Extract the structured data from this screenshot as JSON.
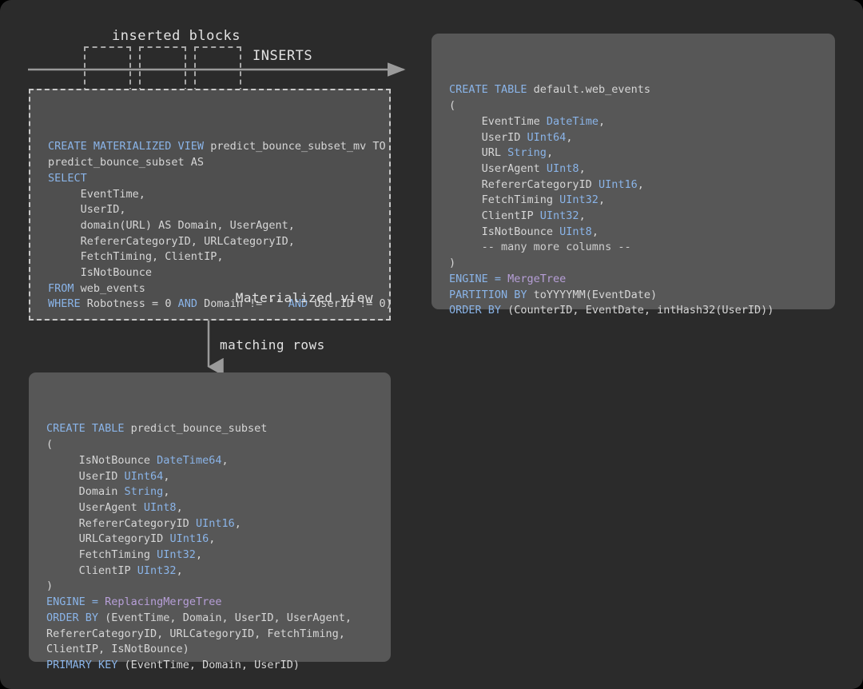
{
  "diagram": {
    "title_labels": {
      "inserted_blocks": "inserted blocks",
      "inserts": "INSERTS",
      "matching_rows": "matching rows",
      "materialized_view_caption": "Materialized view"
    },
    "colors": {
      "page_background": "#2b2b2b",
      "outer_border": "#000000",
      "panel_dashed_background": "#4f4f4f",
      "panel_solid_background": "#575757",
      "keyword": "#8ab4e8",
      "engine": "#b79fd8",
      "plain_text": "#d6d6d6",
      "arrow": "#9a9a9a",
      "dashed_border": "#c9c9c9"
    },
    "inserted_block_count": 3
  },
  "materialized_view_panel": {
    "caption": "Materialized view",
    "lines": [
      [
        {
          "t": "CREATE MATERIALIZED VIEW ",
          "c": "kw"
        },
        {
          "t": "predict_bounce_subset_mv TO",
          "c": "plain"
        }
      ],
      [
        {
          "t": "predict_bounce_subset AS",
          "c": "plain"
        }
      ],
      [
        {
          "t": "SELECT",
          "c": "kw"
        }
      ],
      [
        {
          "t": "     EventTime,",
          "c": "plain"
        }
      ],
      [
        {
          "t": "     UserID,",
          "c": "plain"
        }
      ],
      [
        {
          "t": "     domain(URL) AS Domain, UserAgent,",
          "c": "plain"
        }
      ],
      [
        {
          "t": "     RefererCategoryID, URLCategoryID,",
          "c": "plain"
        }
      ],
      [
        {
          "t": "     FetchTiming, ClientIP,",
          "c": "plain"
        }
      ],
      [
        {
          "t": "     IsNotBounce",
          "c": "plain"
        }
      ],
      [
        {
          "t": "FROM ",
          "c": "kw"
        },
        {
          "t": "web_events",
          "c": "plain"
        }
      ],
      [
        {
          "t": "WHERE ",
          "c": "kw"
        },
        {
          "t": "Robotness = 0 ",
          "c": "plain"
        },
        {
          "t": "AND ",
          "c": "kw"
        },
        {
          "t": "Domain != '' ",
          "c": "plain"
        },
        {
          "t": "AND ",
          "c": "kw"
        },
        {
          "t": "UserID != 0)",
          "c": "plain"
        }
      ]
    ]
  },
  "web_events_panel": {
    "lines": [
      [
        {
          "t": "CREATE TABLE ",
          "c": "kw"
        },
        {
          "t": "default.web_events",
          "c": "plain"
        }
      ],
      [
        {
          "t": "(",
          "c": "plain"
        }
      ],
      [
        {
          "t": "     EventTime ",
          "c": "plain"
        },
        {
          "t": "DateTime",
          "c": "kw"
        },
        {
          "t": ",",
          "c": "plain"
        }
      ],
      [
        {
          "t": "     UserID ",
          "c": "plain"
        },
        {
          "t": "UInt64",
          "c": "kw"
        },
        {
          "t": ",",
          "c": "plain"
        }
      ],
      [
        {
          "t": "     URL ",
          "c": "plain"
        },
        {
          "t": "String",
          "c": "kw"
        },
        {
          "t": ",",
          "c": "plain"
        }
      ],
      [
        {
          "t": "     UserAgent ",
          "c": "plain"
        },
        {
          "t": "UInt8",
          "c": "kw"
        },
        {
          "t": ",",
          "c": "plain"
        }
      ],
      [
        {
          "t": "     RefererCategoryID ",
          "c": "plain"
        },
        {
          "t": "UInt16",
          "c": "kw"
        },
        {
          "t": ",",
          "c": "plain"
        }
      ],
      [
        {
          "t": "     FetchTiming ",
          "c": "plain"
        },
        {
          "t": "UInt32",
          "c": "kw"
        },
        {
          "t": ",",
          "c": "plain"
        }
      ],
      [
        {
          "t": "     ClientIP ",
          "c": "plain"
        },
        {
          "t": "UInt32",
          "c": "kw"
        },
        {
          "t": ",",
          "c": "plain"
        }
      ],
      [
        {
          "t": "     IsNotBounce ",
          "c": "plain"
        },
        {
          "t": "UInt8",
          "c": "kw"
        },
        {
          "t": ",",
          "c": "plain"
        }
      ],
      [
        {
          "t": "     -- many more columns --",
          "c": "cmt"
        }
      ],
      [
        {
          "t": ")",
          "c": "plain"
        }
      ],
      [
        {
          "t": "ENGINE = ",
          "c": "kw"
        },
        {
          "t": "MergeTree",
          "c": "eng"
        }
      ],
      [
        {
          "t": "PARTITION BY ",
          "c": "kw"
        },
        {
          "t": "toYYYYMM(EventDate)",
          "c": "plain"
        }
      ],
      [
        {
          "t": "ORDER BY ",
          "c": "kw"
        },
        {
          "t": "(CounterID, EventDate, intHash32(UserID))",
          "c": "plain"
        }
      ]
    ]
  },
  "subset_table_panel": {
    "lines": [
      [
        {
          "t": "CREATE TABLE ",
          "c": "kw"
        },
        {
          "t": "predict_bounce_subset",
          "c": "plain"
        }
      ],
      [
        {
          "t": "(",
          "c": "plain"
        }
      ],
      [
        {
          "t": "     IsNotBounce ",
          "c": "plain"
        },
        {
          "t": "DateTime64",
          "c": "kw"
        },
        {
          "t": ",",
          "c": "plain"
        }
      ],
      [
        {
          "t": "     UserID ",
          "c": "plain"
        },
        {
          "t": "UInt64",
          "c": "kw"
        },
        {
          "t": ",",
          "c": "plain"
        }
      ],
      [
        {
          "t": "     Domain ",
          "c": "plain"
        },
        {
          "t": "String",
          "c": "kw"
        },
        {
          "t": ",",
          "c": "plain"
        }
      ],
      [
        {
          "t": "     UserAgent ",
          "c": "plain"
        },
        {
          "t": "UInt8",
          "c": "kw"
        },
        {
          "t": ",",
          "c": "plain"
        }
      ],
      [
        {
          "t": "     RefererCategoryID ",
          "c": "plain"
        },
        {
          "t": "UInt16",
          "c": "kw"
        },
        {
          "t": ",",
          "c": "plain"
        }
      ],
      [
        {
          "t": "     URLCategoryID ",
          "c": "plain"
        },
        {
          "t": "UInt16",
          "c": "kw"
        },
        {
          "t": ",",
          "c": "plain"
        }
      ],
      [
        {
          "t": "     FetchTiming ",
          "c": "plain"
        },
        {
          "t": "UInt32",
          "c": "kw"
        },
        {
          "t": ",",
          "c": "plain"
        }
      ],
      [
        {
          "t": "     ClientIP ",
          "c": "plain"
        },
        {
          "t": "UInt32",
          "c": "kw"
        },
        {
          "t": ",",
          "c": "plain"
        }
      ],
      [
        {
          "t": ")",
          "c": "plain"
        }
      ],
      [
        {
          "t": "ENGINE = ",
          "c": "kw"
        },
        {
          "t": "ReplacingMergeTree",
          "c": "eng"
        }
      ],
      [
        {
          "t": "ORDER BY ",
          "c": "kw"
        },
        {
          "t": "(EventTime, Domain, UserID, UserAgent,",
          "c": "plain"
        }
      ],
      [
        {
          "t": "RefererCategoryID, URLCategoryID, FetchTiming,",
          "c": "plain"
        }
      ],
      [
        {
          "t": "ClientIP, IsNotBounce)",
          "c": "plain"
        }
      ],
      [
        {
          "t": "PRIMARY KEY ",
          "c": "kw"
        },
        {
          "t": "(EventTime, Domain, UserID)",
          "c": "plain"
        }
      ]
    ]
  }
}
